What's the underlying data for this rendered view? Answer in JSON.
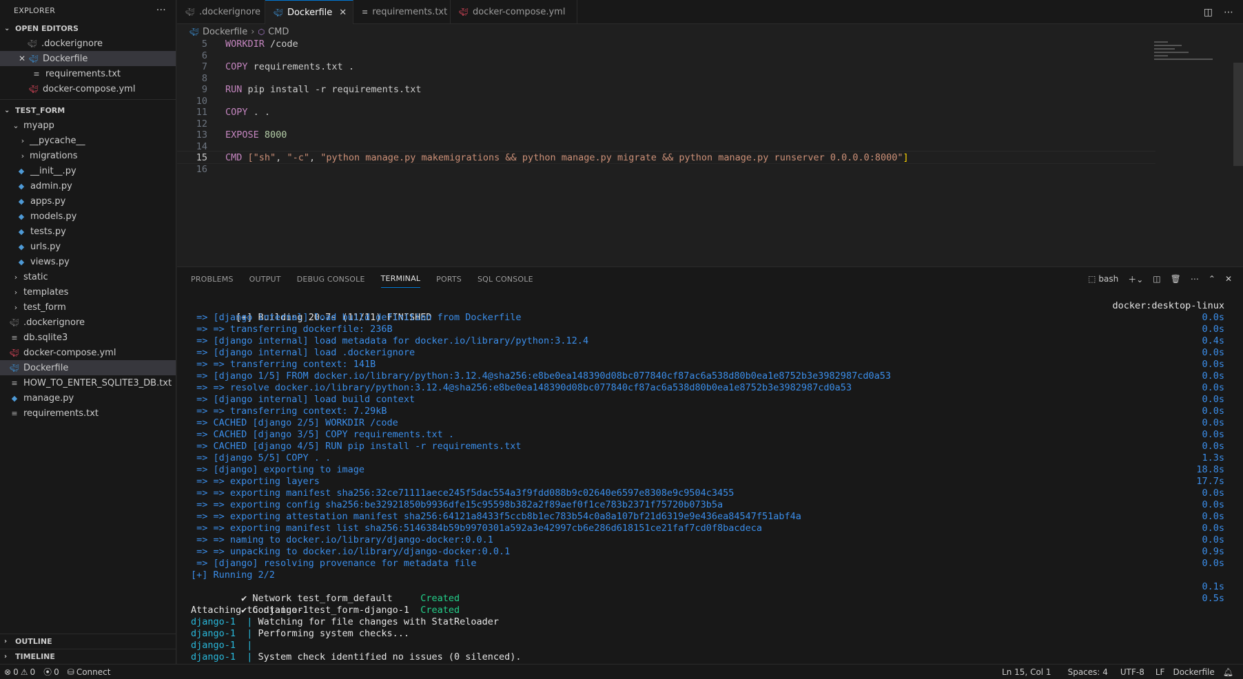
{
  "sidebar": {
    "title": "EXPLORER",
    "more": "···",
    "open_editors_label": "OPEN EDITORS",
    "open_editors": [
      ".dockerignore",
      "Dockerfile",
      "requirements.txt",
      "docker-compose.yml"
    ],
    "workspace_label": "TEST_FORM",
    "tree": {
      "myapp": "myapp",
      "pycache": "__pycache__",
      "migrations": "migrations",
      "init": "__init__.py",
      "admin": "admin.py",
      "apps": "apps.py",
      "models": "models.py",
      "tests": "tests.py",
      "urls": "urls.py",
      "views": "views.py",
      "static": "static",
      "templates": "templates",
      "test_form": "test_form",
      "dockerignore": ".dockerignore",
      "db": "db.sqlite3",
      "compose": "docker-compose.yml",
      "dockerfile": "Dockerfile",
      "howto": "HOW_TO_ENTER_SQLITE3_DB.txt",
      "manage": "manage.py",
      "requirements": "requirements.txt"
    },
    "outline_label": "OUTLINE",
    "timeline_label": "TIMELINE"
  },
  "tabs": [
    ".dockerignore",
    "Dockerfile",
    "requirements.txt",
    "docker-compose.yml"
  ],
  "breadcrumb": {
    "file": "Dockerfile",
    "symbol": "CMD"
  },
  "editor": {
    "line_numbers": [
      "5",
      "6",
      "7",
      "8",
      "9",
      "10",
      "11",
      "12",
      "13",
      "14",
      "15",
      "16"
    ],
    "l5_kw": "WORKDIR",
    "l5_arg": " /code",
    "l7_kw": "COPY",
    "l7_arg": " requirements.txt .",
    "l9_kw": "RUN",
    "l9_arg": " pip install -r requirements.txt",
    "l11_kw": "COPY",
    "l11_arg": " . .",
    "l13_kw": "EXPOSE",
    "l13_arg": "8000",
    "l15_kw": "CMD",
    "l15_a": " [",
    "l15_s1": "\"sh\"",
    "l15_c1": ", ",
    "l15_s2": "\"-c\"",
    "l15_c2": ", ",
    "l15_s3": "\"python manage.py makemigrations && python manage.py migrate && python manage.py runserver 0.0.0.0:8000\"",
    "l15_b": "]"
  },
  "panel": {
    "tabs": [
      "PROBLEMS",
      "OUTPUT",
      "DEBUG CONSOLE",
      "TERMINAL",
      "PORTS",
      "SQL CONSOLE"
    ],
    "shell": "bash"
  },
  "terminal": {
    "header": "[+] Building 20.7s (11/11) FINISHED",
    "context": "docker:desktop-linux",
    "build_lines": [
      {
        "text": " => [django internal] load build definition from Dockerfile",
        "time": "0.0s"
      },
      {
        "text": " => => transferring dockerfile: 236B",
        "time": "0.0s"
      },
      {
        "text": " => [django internal] load metadata for docker.io/library/python:3.12.4",
        "time": "0.4s"
      },
      {
        "text": " => [django internal] load .dockerignore",
        "time": "0.0s"
      },
      {
        "text": " => => transferring context: 141B",
        "time": "0.0s"
      },
      {
        "text": " => [django 1/5] FROM docker.io/library/python:3.12.4@sha256:e8be0ea148390d08bc077840cf87ac6a538d80b0ea1e8752b3e3982987cd0a53",
        "time": "0.0s"
      },
      {
        "text": " => => resolve docker.io/library/python:3.12.4@sha256:e8be0ea148390d08bc077840cf87ac6a538d80b0ea1e8752b3e3982987cd0a53",
        "time": "0.0s"
      },
      {
        "text": " => [django internal] load build context",
        "time": "0.0s"
      },
      {
        "text": " => => transferring context: 7.29kB",
        "time": "0.0s"
      },
      {
        "text": " => CACHED [django 2/5] WORKDIR /code",
        "time": "0.0s"
      },
      {
        "text": " => CACHED [django 3/5] COPY requirements.txt .",
        "time": "0.0s"
      },
      {
        "text": " => CACHED [django 4/5] RUN pip install -r requirements.txt",
        "time": "0.0s"
      },
      {
        "text": " => [django 5/5] COPY . .",
        "time": "1.3s"
      },
      {
        "text": " => [django] exporting to image",
        "time": "18.8s"
      },
      {
        "text": " => => exporting layers",
        "time": "17.7s"
      },
      {
        "text": " => => exporting manifest sha256:32ce71111aece245f5dac554a3f9fdd088b9c02640e6597e8308e9c9504c3455",
        "time": "0.0s"
      },
      {
        "text": " => => exporting config sha256:be32921850b9936dfe15c95598b382a2f89aef0f1ce783b2371f75720b073b5a",
        "time": "0.0s"
      },
      {
        "text": " => => exporting attestation manifest sha256:64121a8433f5ccb8b1ec783b54c0a8a107bf21d6319e9e436ea84547f51abf4a",
        "time": "0.0s"
      },
      {
        "text": " => => exporting manifest list sha256:5146384b59b9970301a592a3e42997cb6e286d618151ce21faf7cd0f8bacdeca",
        "time": "0.0s"
      },
      {
        "text": " => => naming to docker.io/library/django-docker:0.0.1",
        "time": "0.0s"
      },
      {
        "text": " => => unpacking to docker.io/library/django-docker:0.0.1",
        "time": "0.9s"
      },
      {
        "text": " => [django] resolving provenance for metadata file",
        "time": "0.0s"
      }
    ],
    "running": "[+] Running 2/2",
    "created": [
      {
        "name": " ✔ Network test_form_default     ",
        "status": "Created",
        "time": "0.1s"
      },
      {
        "name": " ✔ Container test_form-django-1  ",
        "status": "Created",
        "time": "0.5s"
      }
    ],
    "attaching": "Attaching to django-1",
    "logs": [
      {
        "prefix": "django-1  | ",
        "text": "Watching for file changes with StatReloader"
      },
      {
        "prefix": "django-1  | ",
        "text": "Performing system checks..."
      },
      {
        "prefix": "django-1  | ",
        "text": ""
      },
      {
        "prefix": "django-1  | ",
        "text": "System check identified no issues (0 silenced)."
      }
    ]
  },
  "statusbar": {
    "errors": "0",
    "warnings": "0",
    "ports": "0",
    "connect": "Connect",
    "position": "Ln 15, Col 1",
    "spaces": "Spaces: 4",
    "encoding": "UTF-8",
    "eol": "LF",
    "language": "Dockerfile"
  },
  "colors": {
    "accent": "#0078d4",
    "docker": "#3d8fd1",
    "yml": "#e84a5f",
    "terminal_blue": "#3b8eea",
    "terminal_green": "#23d18b"
  }
}
